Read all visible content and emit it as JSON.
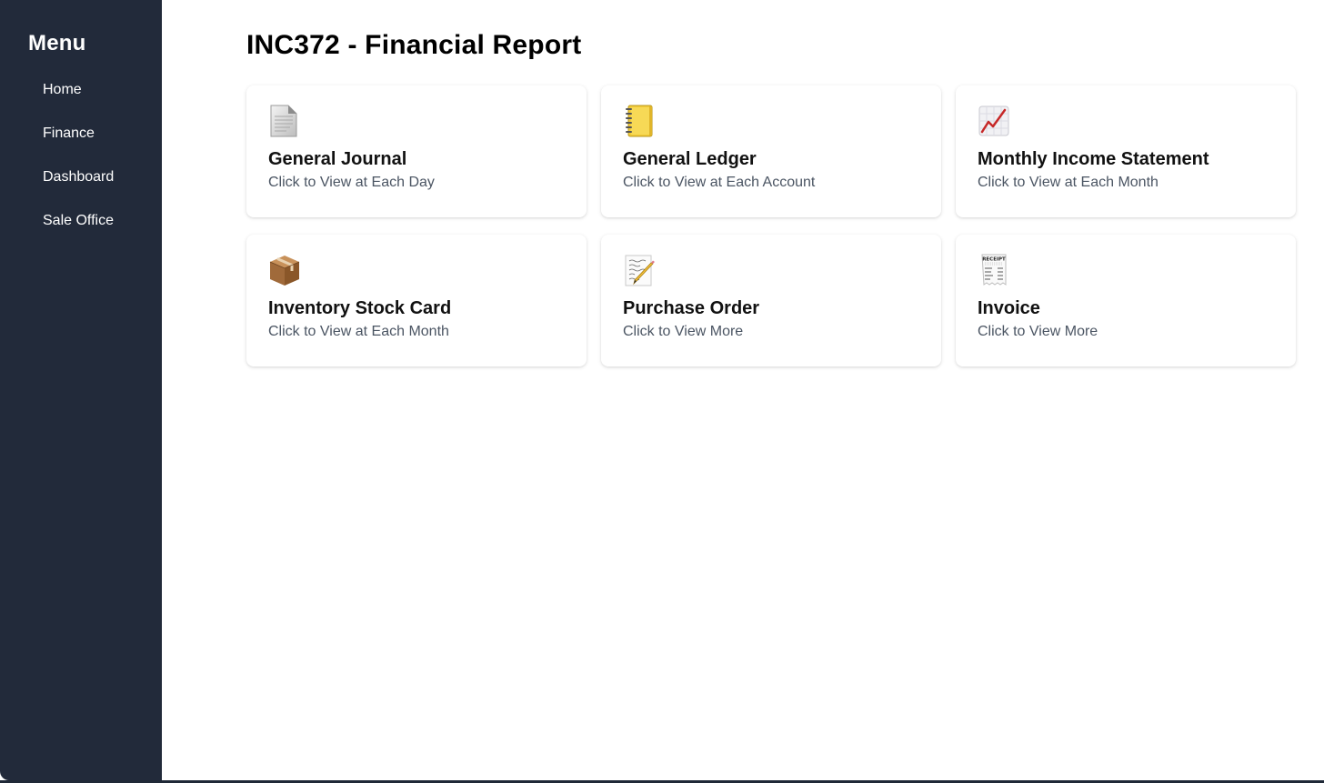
{
  "sidebar": {
    "title": "Menu",
    "items": [
      {
        "label": "Home"
      },
      {
        "label": "Finance"
      },
      {
        "label": "Dashboard"
      },
      {
        "label": "Sale Office"
      }
    ]
  },
  "main": {
    "title": "INC372 - Financial Report",
    "cards": [
      {
        "icon": "document-icon",
        "title": "General Journal",
        "subtitle": "Click to View at Each Day"
      },
      {
        "icon": "ledger-book-icon",
        "title": "General Ledger",
        "subtitle": "Click to View at Each Account"
      },
      {
        "icon": "chart-increasing-icon",
        "title": "Monthly Income Statement",
        "subtitle": "Click to View at Each Month"
      },
      {
        "icon": "package-box-icon",
        "title": "Inventory Stock Card",
        "subtitle": "Click to View at Each Month"
      },
      {
        "icon": "memo-pencil-icon",
        "title": "Purchase Order",
        "subtitle": "Click to View More"
      },
      {
        "icon": "receipt-icon",
        "title": "Invoice",
        "subtitle": "Click to View More",
        "icon_text": "RECEIPT"
      }
    ]
  },
  "colors": {
    "sidebar_bg": "#222a3a",
    "main_bg": "#ffffff",
    "title_text": "#000000",
    "subtitle_text": "#4b5563"
  }
}
